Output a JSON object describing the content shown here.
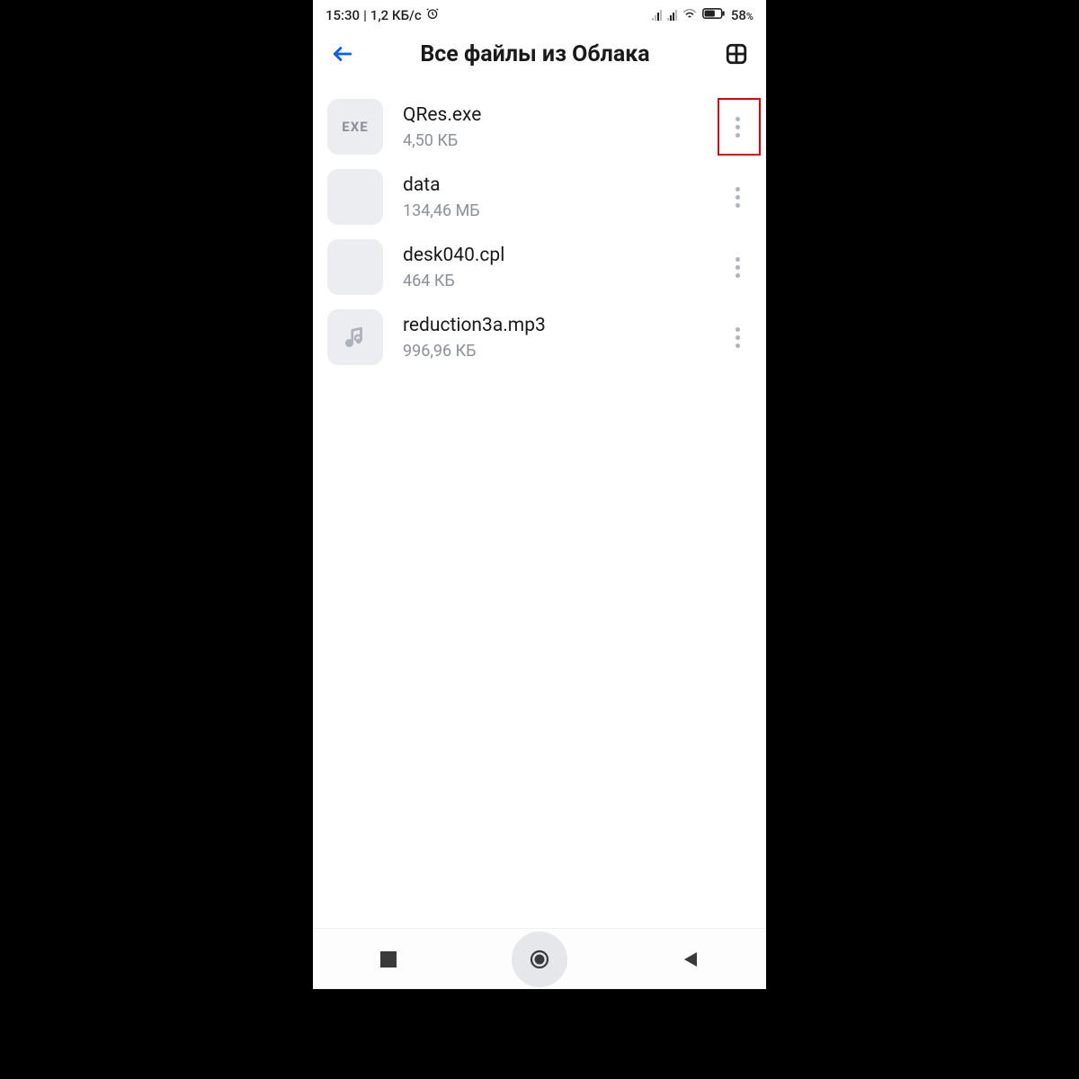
{
  "status": {
    "time": "15:30",
    "net_speed": "1,2 КБ/с",
    "battery_pct": "58",
    "battery_unit": "%"
  },
  "header": {
    "title": "Все файлы из Облака"
  },
  "files": [
    {
      "name": "QRes.exe",
      "size": "4,50 КБ",
      "thumb_label": "EXE",
      "thumb_icon": "",
      "highlighted": true
    },
    {
      "name": "data",
      "size": "134,46 МБ",
      "thumb_label": "",
      "thumb_icon": "",
      "highlighted": false
    },
    {
      "name": "desk040.cpl",
      "size": "464 КБ",
      "thumb_label": "",
      "thumb_icon": "",
      "highlighted": false
    },
    {
      "name": "reduction3a.mp3",
      "size": "996,96 КБ",
      "thumb_label": "",
      "thumb_icon": "music",
      "highlighted": false
    }
  ]
}
